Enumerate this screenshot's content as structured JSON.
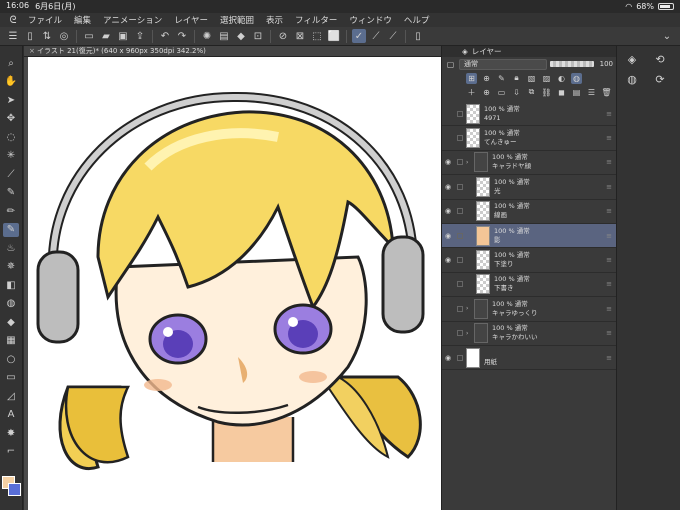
{
  "status": {
    "time": "16:06",
    "date": "6月6日(月)",
    "battery": "68%",
    "battery_level": 0.68
  },
  "menu": [
    "ファイル",
    "編集",
    "アニメーション",
    "レイヤー",
    "選択範囲",
    "表示",
    "フィルター",
    "ウィンドウ",
    "ヘルプ"
  ],
  "document": {
    "title": "イラスト 21(復元)* (640 x 960px 350dpi 342.2%)"
  },
  "layer_panel": {
    "title": "レイヤー",
    "blend_mode": "通常",
    "opacity": "100",
    "layers": [
      {
        "opacity": "100 %",
        "mode": "通常",
        "name": "4971",
        "visible": false,
        "thumb": "checker",
        "folder": false,
        "selected": false
      },
      {
        "opacity": "100 %",
        "mode": "通常",
        "name": "てんきゅー",
        "visible": false,
        "thumb": "checker",
        "folder": false,
        "selected": false
      },
      {
        "opacity": "100 %",
        "mode": "通常",
        "name": "キャラドヤ顔",
        "visible": true,
        "thumb": "none",
        "folder": true,
        "selected": false
      },
      {
        "opacity": "100 %",
        "mode": "通常",
        "name": "光",
        "visible": true,
        "thumb": "checker",
        "folder": false,
        "selected": false
      },
      {
        "opacity": "100 %",
        "mode": "通常",
        "name": "線画",
        "visible": true,
        "thumb": "checker",
        "folder": false,
        "selected": false
      },
      {
        "opacity": "100 %",
        "mode": "通常",
        "name": "影",
        "visible": true,
        "thumb": "peach",
        "folder": false,
        "selected": true
      },
      {
        "opacity": "100 %",
        "mode": "通常",
        "name": "下塗り",
        "visible": true,
        "thumb": "checker",
        "folder": false,
        "selected": false
      },
      {
        "opacity": "100 %",
        "mode": "通常",
        "name": "下書き",
        "visible": false,
        "thumb": "checker",
        "folder": false,
        "selected": false
      },
      {
        "opacity": "100 %",
        "mode": "通常",
        "name": "キャラゆっくり",
        "visible": false,
        "thumb": "none",
        "folder": true,
        "selected": false
      },
      {
        "opacity": "100 %",
        "mode": "通常",
        "name": "キャラかわいい",
        "visible": false,
        "thumb": "none",
        "folder": true,
        "selected": false
      },
      {
        "opacity": "",
        "mode": "",
        "name": "用紙",
        "visible": true,
        "thumb": "white",
        "folder": false,
        "selected": false
      }
    ]
  },
  "colors": {
    "main": "#f4d0a4",
    "sub": "#5a6fd8",
    "accent": "#5b6d8e"
  }
}
